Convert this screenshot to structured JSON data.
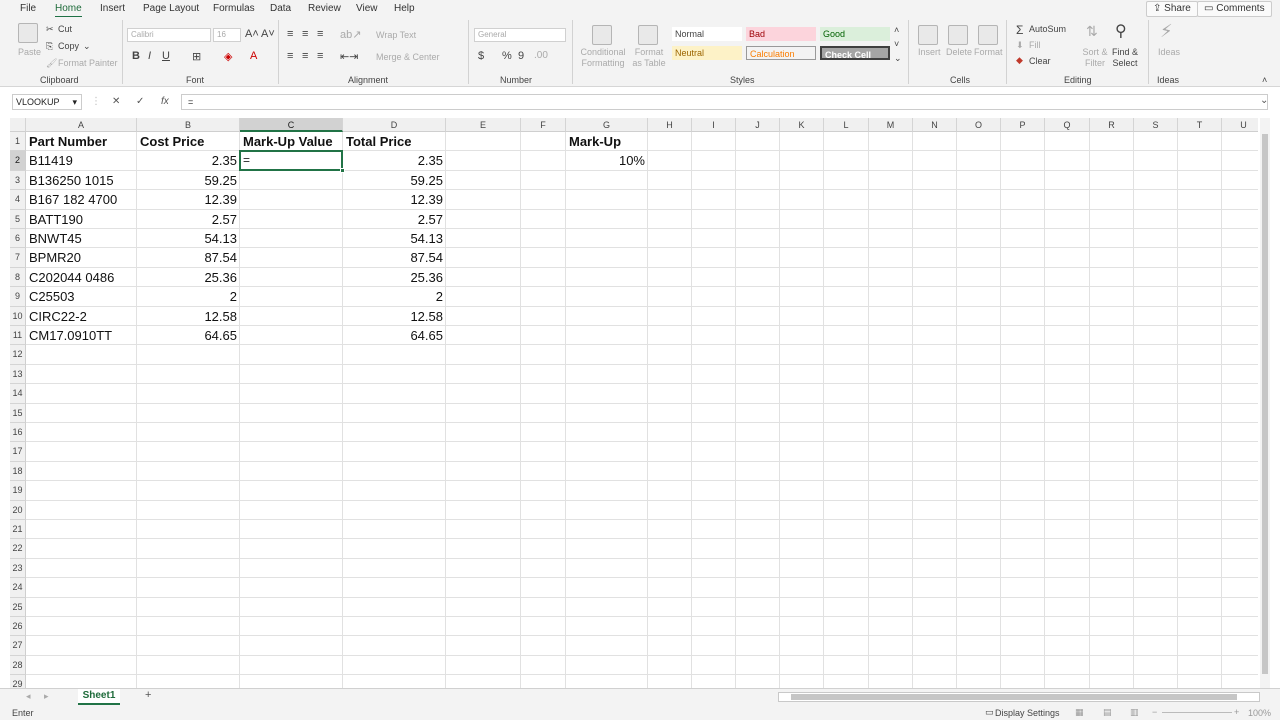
{
  "menu": {
    "tabs": [
      "File",
      "Home",
      "Insert",
      "Page Layout",
      "Formulas",
      "Data",
      "Review",
      "View",
      "Help"
    ],
    "active": "Home",
    "share": "Share",
    "comments": "Comments"
  },
  "ribbon": {
    "clipboard": {
      "paste": "Paste",
      "cut": "Cut",
      "copy": "Copy",
      "format_painter": "Format Painter",
      "label": "Clipboard"
    },
    "font": {
      "name": "Calibri",
      "size": "16",
      "bold": "B",
      "italic": "I",
      "underline": "U",
      "label": "Font"
    },
    "alignment": {
      "wrap": "Wrap Text",
      "merge": "Merge & Center",
      "label": "Alignment"
    },
    "number": {
      "format": "General",
      "label": "Number"
    },
    "styles": {
      "conditional": "Conditional Formatting",
      "format_table": "Format as Table",
      "normal": "Normal",
      "bad": "Bad",
      "good": "Good",
      "neutral": "Neutral",
      "calculation": "Calculation",
      "check_cell": "Check Cell",
      "label": "Styles"
    },
    "cells": {
      "insert": "Insert",
      "delete": "Delete",
      "format": "Format",
      "label": "Cells"
    },
    "editing": {
      "autosum": "AutoSum",
      "fill": "Fill",
      "clear": "Clear",
      "sort_filter": "Sort & Filter",
      "find_select": "Find & Select",
      "label": "Editing"
    },
    "ideas": {
      "ideas": "Ideas",
      "label": "Ideas"
    }
  },
  "formula_bar": {
    "name_box": "VLOOKUP",
    "cancel": "✕",
    "enter": "✓",
    "fx": "fx",
    "content": "="
  },
  "sheet": {
    "columns": [
      "A",
      "B",
      "C",
      "D",
      "E",
      "F",
      "G",
      "H",
      "I",
      "J",
      "K",
      "L",
      "M",
      "N",
      "O",
      "P",
      "Q",
      "R",
      "S",
      "T",
      "U"
    ],
    "selected_column": "C",
    "selected_row": 2,
    "headers": {
      "a": "Part Number",
      "b": "Cost Price",
      "c": "Mark-Up Value",
      "d": "Total Price",
      "g": "Mark-Up"
    },
    "markup_value": "10%",
    "editing_cell_text": "=",
    "rows": [
      {
        "part": "B11419",
        "cost": "2.35",
        "total": "2.35"
      },
      {
        "part": "B136250 1015",
        "cost": "59.25",
        "total": "59.25"
      },
      {
        "part": "B167 182 4700",
        "cost": "12.39",
        "total": "12.39"
      },
      {
        "part": "BATT190",
        "cost": "2.57",
        "total": "2.57"
      },
      {
        "part": "BNWT45",
        "cost": "54.13",
        "total": "54.13"
      },
      {
        "part": "BPMR20",
        "cost": "87.54",
        "total": "87.54"
      },
      {
        "part": "C202044 0486",
        "cost": "25.36",
        "total": "25.36"
      },
      {
        "part": "C25503",
        "cost": "2",
        "total": "2"
      },
      {
        "part": "CIRC22-2",
        "cost": "12.58",
        "total": "12.58"
      },
      {
        "part": "CM17.0910TT",
        "cost": "64.65",
        "total": "64.65"
      }
    ],
    "row_numbers": [
      "1",
      "2",
      "3",
      "4",
      "5",
      "6",
      "7",
      "8",
      "9",
      "10",
      "11",
      "12",
      "13",
      "14",
      "15",
      "16",
      "17",
      "18",
      "19",
      "20",
      "21",
      "22",
      "23",
      "24",
      "25",
      "26",
      "27",
      "28",
      "29"
    ]
  },
  "sheet_tabs": {
    "active": "Sheet1",
    "add": "+"
  },
  "status": {
    "mode": "Enter",
    "display_settings": "Display Settings",
    "zoom": "100%"
  }
}
